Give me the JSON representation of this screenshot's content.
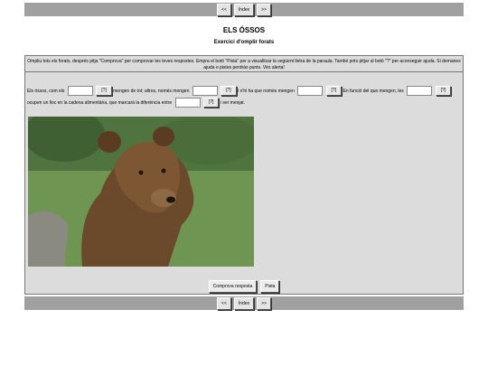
{
  "nav": {
    "prev": "<<",
    "index": "Índex",
    "next": ">>"
  },
  "title": "ELS ÓSSOS",
  "subtitle": "Exercici d'omplir forats",
  "instructions": "Ompliu tots els forats, després pitja \"Comprova\" per comprovar les teves respostes. Empra el botó \"Pista\" per a visualitzar la següent lletra de la paraula. També pots pitjar al botó \"?\" per aconseguir ajuda. Si demanes ajuda o pistes perdràs punts. Vés alerta!",
  "exercise": {
    "seg1": "Els óssos, com els",
    "seg2": "mengen de tot; altres, només mengen",
    "seg3": "i n'hi ha que només mengen",
    "seg4": "En funció del que mengen, les",
    "seg5": "ocupen un lloc en la cadena alimentària, que marcarà la diferència entre",
    "seg6": "i ser menjat.",
    "hint": "[?]"
  },
  "photo_alt": "Brown bear",
  "actions": {
    "check": "Comprova resposta",
    "hint": "Pista"
  }
}
